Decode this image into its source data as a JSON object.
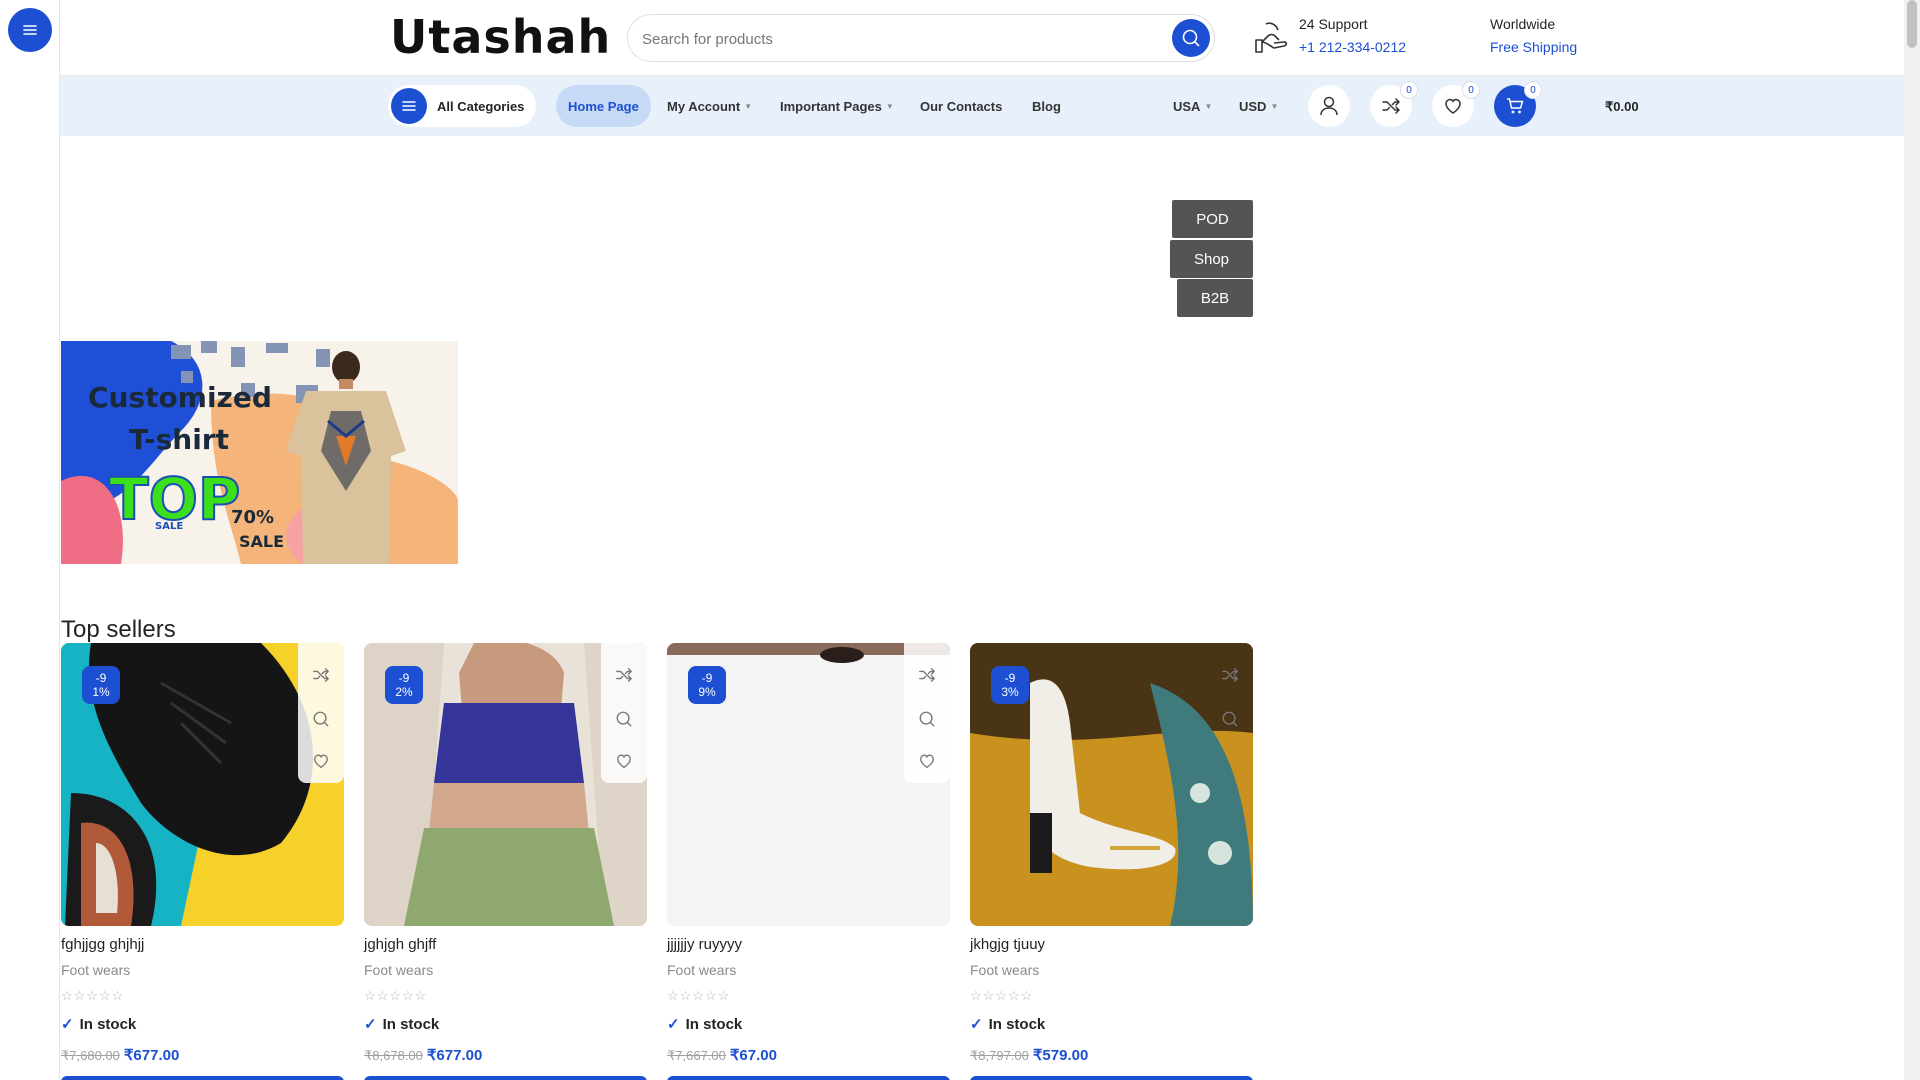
{
  "brand": {
    "logo_text": "Utashah"
  },
  "search": {
    "placeholder": "Search for products"
  },
  "support": {
    "title": "24 Support",
    "phone": "+1 212-334-0212"
  },
  "shipping": {
    "title": "Worldwide",
    "subtitle": "Free Shipping"
  },
  "nav": {
    "all_categories": "All Categories",
    "items": [
      {
        "label": "Home Page"
      },
      {
        "label": "My Account"
      },
      {
        "label": "Important Pages"
      },
      {
        "label": "Our Contacts"
      },
      {
        "label": "Blog"
      }
    ],
    "country": "USA",
    "currency": "USD",
    "compare_count": "0",
    "wishlist_count": "0",
    "cart_count": "0",
    "cart_total": "₹0.00"
  },
  "tags": [
    "POD",
    "Shop",
    "B2B"
  ],
  "banner": {
    "line1": "Customized",
    "line2": "T-shirt",
    "top": "TOP",
    "sale_badge": "SALE",
    "pct": "70%",
    "sale": "SALE"
  },
  "section": {
    "title": "Top sellers"
  },
  "products": [
    {
      "name": "fghjjgg ghjhjj",
      "category": "Foot wears",
      "discount": "-9\n1%",
      "stock": "In stock",
      "old_price": "₹7,680.00",
      "price": "₹677.00",
      "stars": "☆☆☆☆☆"
    },
    {
      "name": "jghjgh ghjff",
      "category": "Foot wears",
      "discount": "-9\n2%",
      "stock": "In stock",
      "old_price": "₹8,678.00",
      "price": "₹677.00",
      "stars": "☆☆☆☆☆"
    },
    {
      "name": "jjjjjjy ruyyyy",
      "category": "Foot wears",
      "discount": "-9\n9%",
      "stock": "In stock",
      "old_price": "₹7,667.00",
      "price": "₹67.00",
      "stars": "☆☆☆☆☆"
    },
    {
      "name": "jkhgjg tjuuy",
      "category": "Foot wears",
      "discount": "-9\n3%",
      "stock": "In stock",
      "old_price": "₹8,797.00",
      "price": "₹579.00",
      "stars": "☆☆☆☆☆"
    }
  ],
  "colors": {
    "accent": "#1c4fd1",
    "nav_bg": "#e8f1fb",
    "tag_bg": "#545454"
  },
  "icons": {
    "rail": "menu-icon",
    "search": "search-icon",
    "support": "support-hand-icon",
    "account": "user-icon",
    "compare": "shuffle-icon",
    "wishlist": "heart-icon",
    "cart": "cart-icon"
  }
}
